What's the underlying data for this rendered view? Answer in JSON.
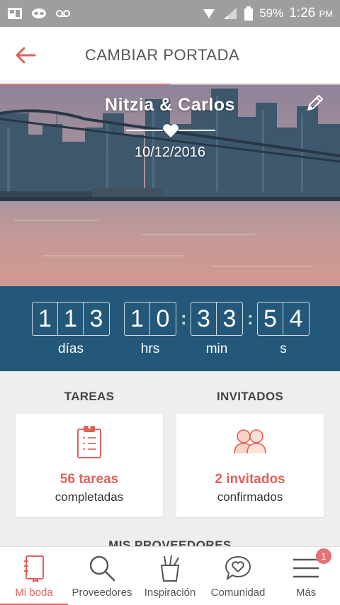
{
  "status_bar": {
    "battery": "59%",
    "time": "1:26",
    "ampm": "PM"
  },
  "header": {
    "title": "CAMBIAR PORTADA"
  },
  "cover": {
    "names": "Nitzia & Carlos",
    "date": "10/12/2016"
  },
  "countdown": {
    "days": [
      "1",
      "1",
      "3"
    ],
    "hours": [
      "1",
      "0"
    ],
    "minutes": [
      "3",
      "3"
    ],
    "seconds": [
      "5",
      "4"
    ],
    "labels": {
      "days": "días",
      "hours": "hrs",
      "minutes": "min",
      "seconds": "s"
    }
  },
  "summary": {
    "tasks": {
      "title": "TAREAS",
      "count": "56 tareas",
      "sub": "completadas"
    },
    "guests": {
      "title": "INVITADOS",
      "count": "2 invitados",
      "sub": "confirmados"
    },
    "next_section": "MIS PROVEEDORES"
  },
  "nav": {
    "items": [
      {
        "label": "Mi boda",
        "icon": "notebook-icon"
      },
      {
        "label": "Proveedores",
        "icon": "search-icon"
      },
      {
        "label": "Inspiración",
        "icon": "pencil-cup-icon"
      },
      {
        "label": "Comunidad",
        "icon": "heart-chat-icon"
      },
      {
        "label": "Más",
        "icon": "menu-icon"
      }
    ],
    "badge": "1"
  },
  "colors": {
    "accent": "#e0615a",
    "countdown_bg": "#24587a",
    "status_bar": "#9e9e9e"
  }
}
